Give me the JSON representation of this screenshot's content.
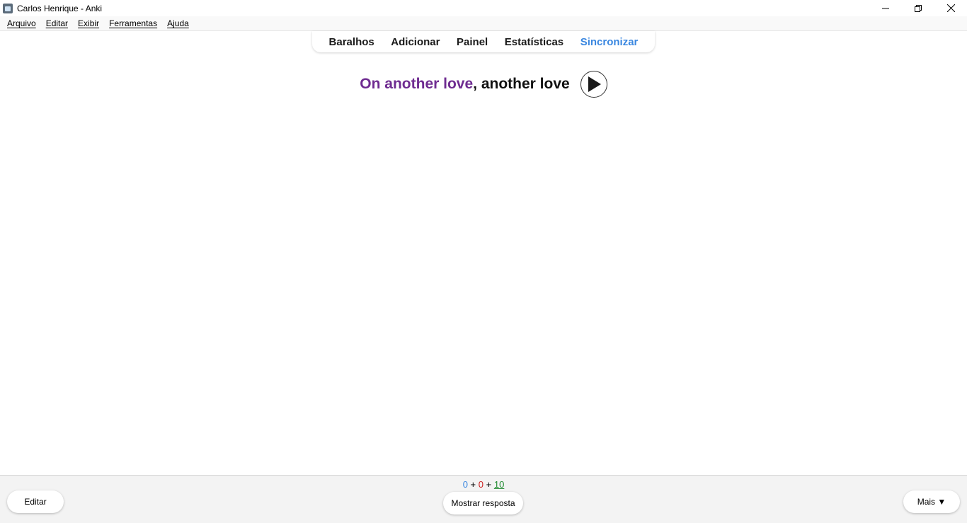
{
  "window": {
    "title": "Carlos Henrique - Anki",
    "controls": {
      "minimize": "—",
      "restore": "❐",
      "close": "✕"
    }
  },
  "menubar": {
    "items": [
      {
        "label": "Arquivo"
      },
      {
        "label": "Editar"
      },
      {
        "label": "Exibir"
      },
      {
        "label": "Ferramentas"
      },
      {
        "label": "Ajuda"
      }
    ]
  },
  "toolbar": {
    "items": [
      {
        "label": "Baralhos"
      },
      {
        "label": "Adicionar"
      },
      {
        "label": "Painel"
      },
      {
        "label": "Estatísticas"
      },
      {
        "label": "Sincronizar"
      }
    ],
    "sync_color": "#3a87e0"
  },
  "card": {
    "front": "On another love",
    "separator": ", ",
    "back": "another love",
    "play_icon": "play-icon",
    "front_color": "#6f2c91"
  },
  "bottom": {
    "edit_label": "Editar",
    "show_answer_label": "Mostrar resposta",
    "more_label": "Mais ▼",
    "counts": {
      "new": "0",
      "learning": "0",
      "review": "10",
      "plus": "+"
    },
    "count_colors": {
      "new": "#3a87e0",
      "learning": "#cc2222",
      "review": "#1f8a2f"
    }
  }
}
